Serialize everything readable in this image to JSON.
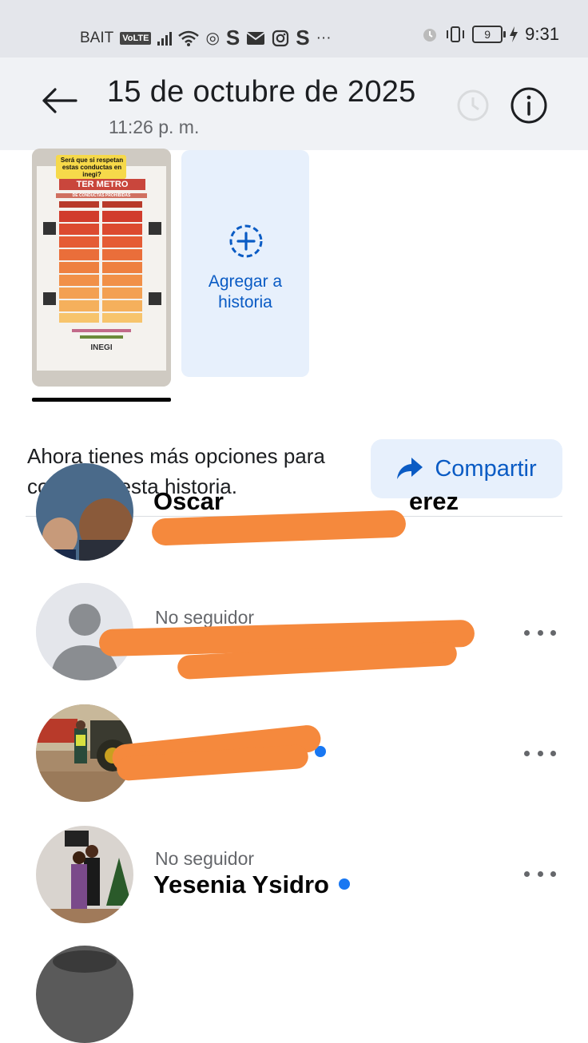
{
  "status_bar": {
    "carrier": "BAIT",
    "volte": "VoLTE",
    "apps_overflow": "···",
    "battery_level": "9",
    "time": "9:31"
  },
  "header": {
    "title": "15 de octubre de 2025",
    "time": "11:26 p. m."
  },
  "thumbnails": {
    "story_caption": "Será que si respetan estas conductas en inegi?",
    "story_poster_heading": "TER METRO",
    "story_poster_sub": "DE CONDUCTAS PROHIBIDAS",
    "story_poster_logo": "INEGI",
    "add_story_label": "Agregar a historia"
  },
  "share": {
    "prompt": "Ahora tienes más opciones para compartir esta historia.",
    "button_label": "Compartir"
  },
  "viewers": [
    {
      "sub": "",
      "name": "Oscar",
      "name_suffix": "erez"
    },
    {
      "sub": "No seguidor",
      "name": ""
    },
    {
      "sub": "",
      "name": ""
    },
    {
      "sub": "No seguidor",
      "name": "Yesenia Ysidro"
    }
  ],
  "colors": {
    "accent": "#0a5bc4",
    "header_bg": "#f0f2f5",
    "redaction": "#f5893d",
    "online_dot": "#1877f2"
  }
}
